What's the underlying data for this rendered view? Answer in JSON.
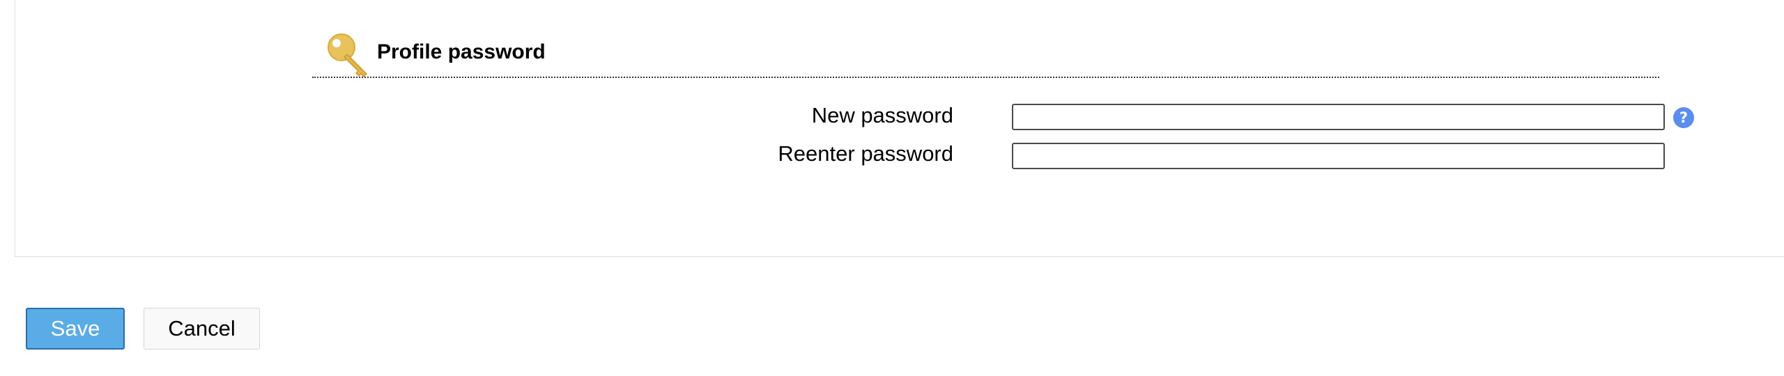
{
  "section": {
    "title": "Profile password",
    "icon": "key-icon"
  },
  "fields": {
    "new_password": {
      "label": "New password",
      "value": "",
      "help_icon": "question-mark-icon"
    },
    "reenter_password": {
      "label": "Reenter password",
      "value": ""
    }
  },
  "buttons": {
    "save_label": "Save",
    "cancel_label": "Cancel"
  },
  "help": {
    "glyph": "?"
  },
  "colors": {
    "save_button_bg": "#5aace6",
    "help_icon_bg": "#5b8def",
    "key_icon": "#e8c25a"
  }
}
